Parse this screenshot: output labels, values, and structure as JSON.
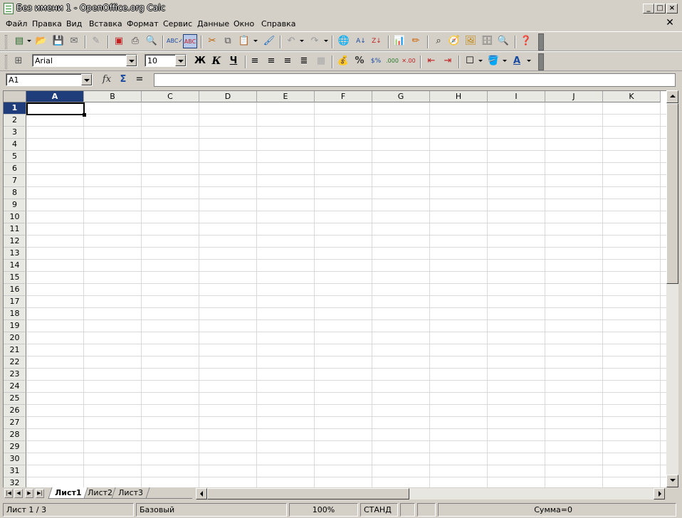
{
  "window": {
    "title": "Без имени 1 - OpenOffice.org Calc"
  },
  "menu": [
    {
      "label": "Файл"
    },
    {
      "label": "Правка"
    },
    {
      "label": "Вид"
    },
    {
      "label": "Вставка"
    },
    {
      "label": "Формат"
    },
    {
      "label": "Сервис"
    },
    {
      "label": "Данные"
    },
    {
      "label": "Окно"
    },
    {
      "label": "Справка"
    }
  ],
  "formatting": {
    "font_name": "Arial",
    "font_size": "10",
    "bold": "Ж",
    "italic": "К",
    "underline": "Ч"
  },
  "formula_bar": {
    "name_box": "A1",
    "function_symbol": "fx",
    "sum_symbol": "Σ",
    "equals": "=",
    "input_value": ""
  },
  "sheet": {
    "columns": [
      "A",
      "B",
      "C",
      "D",
      "E",
      "F",
      "G",
      "H",
      "I",
      "J",
      "K"
    ],
    "rows": [
      "1",
      "2",
      "3",
      "4",
      "5",
      "6",
      "7",
      "8",
      "9",
      "10",
      "11",
      "12",
      "13",
      "14",
      "15",
      "16",
      "17",
      "18",
      "19",
      "20",
      "21",
      "22",
      "23",
      "24",
      "25",
      "26",
      "27",
      "28",
      "29",
      "30",
      "31",
      "32"
    ],
    "active_cell": "A1"
  },
  "tabs": [
    {
      "label": "Лист1"
    },
    {
      "label": "Лист2"
    },
    {
      "label": "Лист3"
    }
  ],
  "status": {
    "sheet": "Лист 1 / 3",
    "page_style": "Базовый",
    "zoom": "100%",
    "mode": "СТАНД",
    "sum": "Сумма=0"
  },
  "colors": {
    "selection_header": "#1f3d7a",
    "chrome": "#d4d0c8",
    "grid": "#d9d9d9"
  }
}
